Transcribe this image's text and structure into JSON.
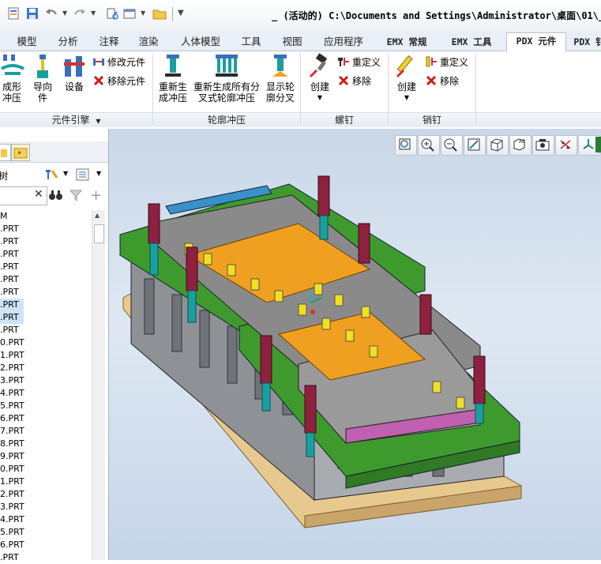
{
  "title_bar": {
    "title": "_ (活动的) C:\\Documents and Settings\\Administrator\\桌面\\01\\_"
  },
  "tabs": [
    {
      "label": "模型"
    },
    {
      "label": "分析"
    },
    {
      "label": "注释"
    },
    {
      "label": "渲染"
    },
    {
      "label": "人体模型"
    },
    {
      "label": "工具"
    },
    {
      "label": "视图"
    },
    {
      "label": "应用程序"
    },
    {
      "label": "EMX 常规"
    },
    {
      "label": "EMX 工具"
    },
    {
      "label": "PDX 元件",
      "active": true
    },
    {
      "label": "PDX 钅"
    }
  ],
  "ribbon": {
    "groups": [
      {
        "label": "元件引擎",
        "has_dropdown": true
      },
      {
        "label": "轮廓冲压"
      },
      {
        "label": "螺钉"
      },
      {
        "label": "销钉"
      }
    ],
    "buttons": {
      "form_punch": [
        "成形",
        "冲压"
      ],
      "guide": [
        "导向",
        "件"
      ],
      "equipment": "设备",
      "modify_component": "修改元件",
      "remove_component": "移除元件",
      "regen_punch": [
        "重新生",
        "成冲压"
      ],
      "regen_all_contour": [
        "重新生成所有分",
        "叉式轮廓冲压"
      ],
      "show_contour_split": [
        "显示轮",
        "廓分叉"
      ],
      "screw_create": "创建",
      "screw_redefine": "重定义",
      "screw_remove": "移除",
      "pin_create": "创建",
      "pin_redefine": "重定义",
      "pin_remove": "移除"
    }
  },
  "left_panel": {
    "header_label": "树",
    "tree_items": [
      {
        "label": "M"
      },
      {
        "label": ".PRT"
      },
      {
        "label": ".PRT"
      },
      {
        "label": ".PRT"
      },
      {
        "label": ".PRT"
      },
      {
        "label": ".PRT"
      },
      {
        "label": ".PRT"
      },
      {
        "label": ".PRT",
        "selected": true
      },
      {
        "label": ".PRT",
        "selected": true
      },
      {
        "label": ".PRT"
      },
      {
        "label": "0.PRT"
      },
      {
        "label": "1.PRT"
      },
      {
        "label": "2.PRT"
      },
      {
        "label": "3.PRT"
      },
      {
        "label": "4.PRT"
      },
      {
        "label": "5.PRT"
      },
      {
        "label": "6.PRT"
      },
      {
        "label": "7.PRT"
      },
      {
        "label": "8.PRT"
      },
      {
        "label": "9.PRT"
      },
      {
        "label": "0.PRT"
      },
      {
        "label": "1.PRT"
      },
      {
        "label": "2.PRT"
      },
      {
        "label": "3.PRT"
      },
      {
        "label": "4.PRT"
      },
      {
        "label": "5.PRT"
      },
      {
        "label": "6.PRT"
      },
      {
        "label": ".PRT"
      }
    ]
  },
  "colors": {
    "die_plate_green": "#3f9a2e",
    "plate_gray": "#8a8a8a",
    "strip_orange": "#f0a020",
    "spring_maroon": "#8e2040",
    "wood_base": "#e7c98f",
    "canvas_top": "#c9d7e8"
  }
}
